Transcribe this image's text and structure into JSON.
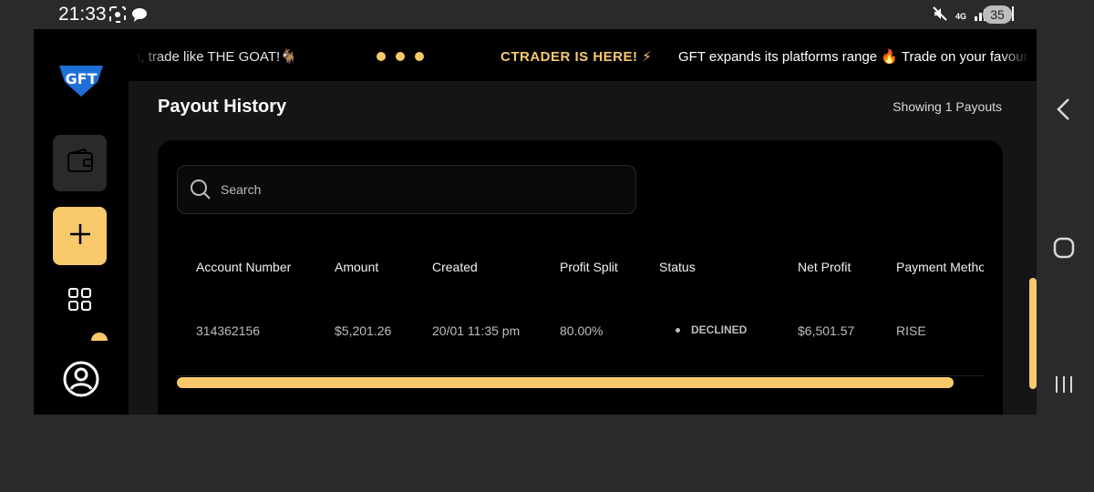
{
  "status_bar": {
    "time": "21:33",
    "network": "4G",
    "battery": "35"
  },
  "ticker": {
    "left_text": "rn, trade like THE GOAT!🐐",
    "highlight": "CTRADER IS HERE! ⚡",
    "right_text": "GFT expands its platforms range 🔥 Trade on your favourite"
  },
  "sidebar": {
    "logo_text": "GFT"
  },
  "page": {
    "title": "Payout History",
    "showing": "Showing 1 Payouts"
  },
  "search": {
    "placeholder": "Search"
  },
  "table": {
    "headers": [
      "Account Number",
      "Amount",
      "Created",
      "Profit Split",
      "Status",
      "Net Profit",
      "Payment Method"
    ],
    "rows": [
      {
        "account_number": "314362156",
        "amount": "$5,201.26",
        "created": "20/01 11:35 pm",
        "profit_split": "80.00%",
        "status": "DECLINED",
        "net_profit": "$6,501.57",
        "payment_method": "RISE"
      }
    ]
  },
  "colors": {
    "accent": "#f8c96a",
    "background": "#000000",
    "panel": "#151517"
  }
}
